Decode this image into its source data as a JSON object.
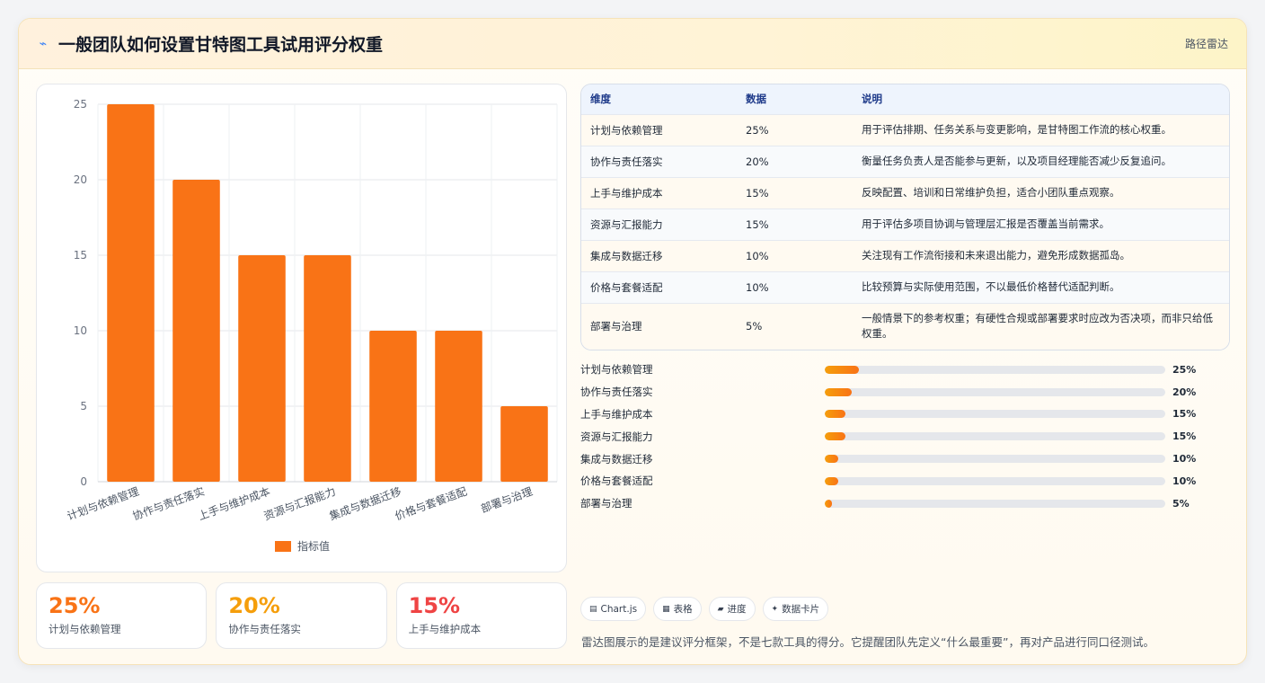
{
  "header": {
    "title": "一般团队如何设置甘特图工具试用评分权重",
    "tag": "路径雷达",
    "icon": "spark-icon"
  },
  "chart_data": {
    "type": "bar",
    "categories": [
      "计划与依赖管理",
      "协作与责任落实",
      "上手与维护成本",
      "资源与汇报能力",
      "集成与数据迁移",
      "价格与套餐适配",
      "部署与治理"
    ],
    "series": [
      {
        "name": "指标值",
        "values": [
          25,
          20,
          15,
          15,
          10,
          10,
          5
        ],
        "color": "#f97316"
      }
    ],
    "y_ticks": [
      0,
      5,
      10,
      15,
      20,
      25
    ],
    "ylim": [
      0,
      25
    ],
    "grid": true,
    "legend": "bottom"
  },
  "stats": [
    {
      "value": "25%",
      "label": "计划与依赖管理",
      "color": "#f97316"
    },
    {
      "value": "20%",
      "label": "协作与责任落实",
      "color": "#f59e0b"
    },
    {
      "value": "15%",
      "label": "上手与维护成本",
      "color": "#ef4444"
    }
  ],
  "table": {
    "headers": [
      "维度",
      "数据",
      "说明"
    ],
    "rows": [
      {
        "dim": "计划与依赖管理",
        "val": "25%",
        "desc": "用于评估排期、任务关系与变更影响，是甘特图工作流的核心权重。"
      },
      {
        "dim": "协作与责任落实",
        "val": "20%",
        "desc": "衡量任务负责人是否能参与更新，以及项目经理能否减少反复追问。"
      },
      {
        "dim": "上手与维护成本",
        "val": "15%",
        "desc": "反映配置、培训和日常维护负担，适合小团队重点观察。"
      },
      {
        "dim": "资源与汇报能力",
        "val": "15%",
        "desc": "用于评估多项目协调与管理层汇报是否覆盖当前需求。"
      },
      {
        "dim": "集成与数据迁移",
        "val": "10%",
        "desc": "关注现有工作流衔接和未来退出能力，避免形成数据孤岛。"
      },
      {
        "dim": "价格与套餐适配",
        "val": "10%",
        "desc": "比较预算与实际使用范围，不以最低价格替代适配判断。"
      },
      {
        "dim": "部署与治理",
        "val": "5%",
        "desc": "一般情景下的参考权重；有硬性合规或部署要求时应改为否决项，而非只给低权重。"
      }
    ]
  },
  "progress": [
    {
      "label": "计划与依赖管理",
      "pct": 25,
      "text": "25%"
    },
    {
      "label": "协作与责任落实",
      "pct": 20,
      "text": "20%"
    },
    {
      "label": "上手与维护成本",
      "pct": 15,
      "text": "15%"
    },
    {
      "label": "资源与汇报能力",
      "pct": 15,
      "text": "15%"
    },
    {
      "label": "集成与数据迁移",
      "pct": 10,
      "text": "10%"
    },
    {
      "label": "价格与套餐适配",
      "pct": 10,
      "text": "10%"
    },
    {
      "label": "部署与治理",
      "pct": 5,
      "text": "5%"
    }
  ],
  "pills": [
    {
      "icon": "chart-icon",
      "glyph": "▤",
      "label": "Chart.js"
    },
    {
      "icon": "table-icon",
      "glyph": "▦",
      "label": "表格"
    },
    {
      "icon": "progress-icon",
      "glyph": "▰",
      "label": "进度"
    },
    {
      "icon": "sparkle-icon",
      "glyph": "✦",
      "label": "数据卡片"
    }
  ],
  "note": "雷达图展示的是建议评分框架，不是七款工具的得分。它提醒团队先定义“什么最重要”，再对产品进行同口径测试。"
}
